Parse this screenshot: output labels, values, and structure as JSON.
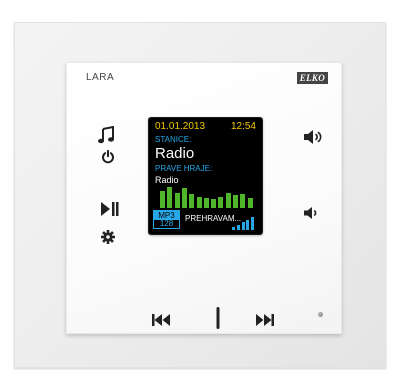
{
  "device": {
    "model": "LARA",
    "brand": "ELKO"
  },
  "display": {
    "date": "01.01.2013",
    "time": "12:54",
    "station_label": "STANICE:",
    "station_name": "Radio",
    "playing_label": "PRAVE HRAJE:",
    "playing_value": "Radio",
    "codec": "MP3",
    "bitrate": "128",
    "status": "PREHRAVAM...",
    "equalizer_levels": [
      0.75,
      0.95,
      0.7,
      0.9,
      0.65,
      0.5,
      0.45,
      0.4,
      0.5,
      0.7,
      0.6,
      0.65,
      0.45
    ],
    "signal_levels": [
      0.2,
      0.4,
      0.6,
      0.8,
      1.0
    ]
  },
  "colors": {
    "date_time": "#f4c800",
    "labels": "#28a7e6",
    "equalizer": "#4fb62c",
    "screen_bg": "#000000",
    "text": "#ffffff"
  },
  "controls": {
    "left_top": "music-note-icon",
    "left_power": "power-icon",
    "left_play_pause": "play-pause-icon",
    "left_settings": "gear-icon",
    "right_volume_up": "volume-up-icon",
    "right_volume_down": "volume-down-icon",
    "bottom_previous": "previous-track-icon",
    "bottom_center": "center-slider-icon",
    "bottom_next": "next-track-icon"
  }
}
